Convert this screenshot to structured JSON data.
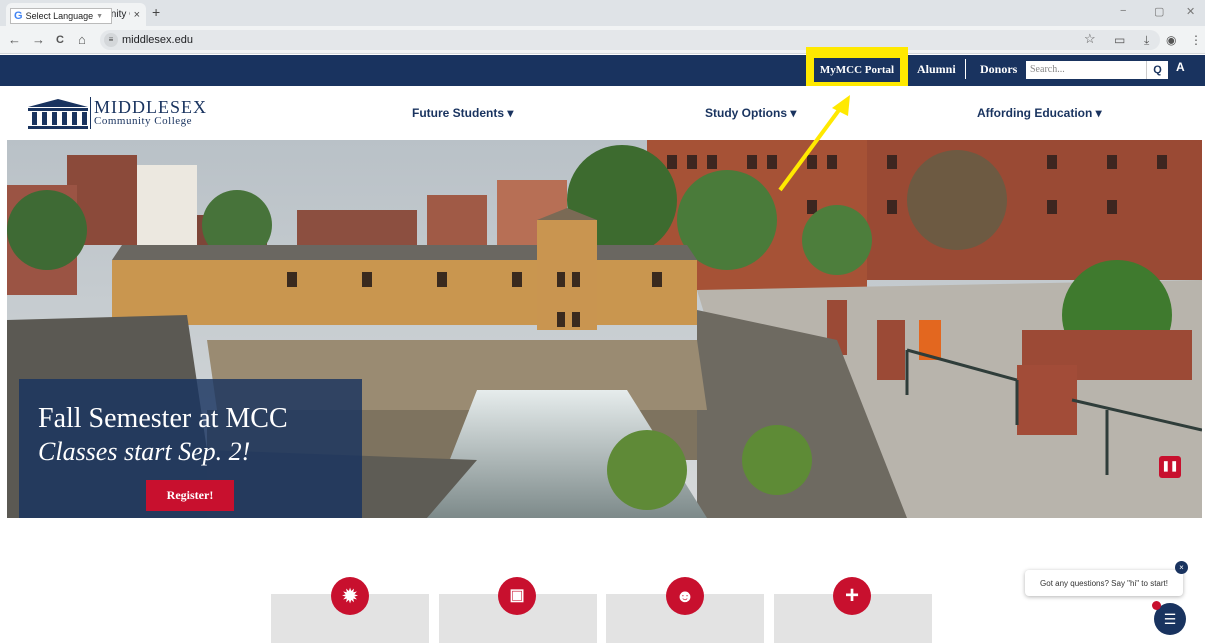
{
  "browser": {
    "tab_title": "Middlesex Community College",
    "tab_close": "×",
    "new_tab": "+",
    "url": "middlesex.edu",
    "back": "←",
    "forward": "→",
    "reload": "C",
    "home": "⌂",
    "site_info": "≡",
    "star": "☆",
    "minimize": "−",
    "restore": "▢",
    "close": "✕",
    "toolbar_icons": [
      "▭",
      "⤓",
      "◉",
      "⋮"
    ]
  },
  "utility": {
    "language_label": "Select Language",
    "language_caret": "▼",
    "google_g": "G",
    "portal_label": "MyMCC Portal",
    "alumni_label": "Alumni",
    "donors_label": "Donors",
    "search_placeholder": "Search...",
    "search_icon": "Q",
    "accessibility_icon": "A"
  },
  "nav": {
    "logo_line1": "MIDDLESEX",
    "logo_line2": "Community College",
    "items": [
      {
        "label": "Future Students ▾"
      },
      {
        "label": "Study Options ▾"
      },
      {
        "label": "Affording Education ▾"
      }
    ]
  },
  "hero": {
    "title": "Fall Semester at MCC",
    "subtitle": "Classes start Sep. 2!",
    "register_label": "Register!",
    "pause_icon": "❚❚"
  },
  "cards": [
    {
      "icon": "✹",
      "icon_name": "badge-icon"
    },
    {
      "icon": "▣",
      "icon_name": "briefcase-icon"
    },
    {
      "icon": "☻",
      "icon_name": "people-icon"
    },
    {
      "icon": "+",
      "icon_name": "plus-icon"
    }
  ],
  "chat": {
    "prompt": "Got any questions? Say \"hi\" to start!",
    "close_icon": "×",
    "open_icon": "☰"
  },
  "colors": {
    "brand_navy": "#19335f",
    "brand_red": "#c8102e",
    "highlight_yellow": "#ffe900"
  }
}
